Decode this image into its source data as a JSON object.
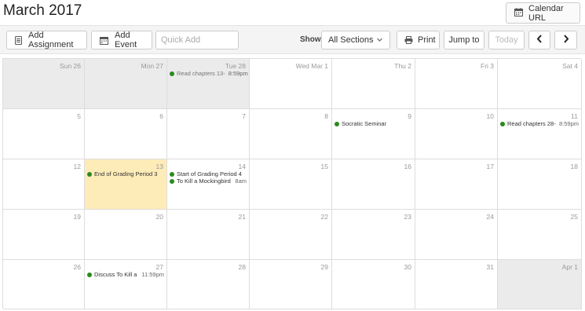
{
  "header": {
    "title": "March 2017",
    "calendar_url_label": "Calendar URL"
  },
  "toolbar": {
    "add_assignment": "Add Assignment",
    "add_event": "Add Event",
    "quick_add_placeholder": "Quick Add",
    "show_label": "Show:",
    "sections_value": "All Sections",
    "print_label": "Print",
    "jump_label": "Jump to",
    "today_label": "Today"
  },
  "icons": {
    "calendar_url": "calendar-icon",
    "add_assignment": "assignment-icon",
    "add_event": "calendar-event-icon",
    "print": "printer-icon",
    "prev": "chevron-left-icon",
    "next": "chevron-right-icon",
    "dropdown": "chevron-down-icon"
  },
  "colors": {
    "event_dot": "#2a8a1e",
    "today_bg": "#fdebb8",
    "outside_month_bg": "#ebebeb"
  },
  "weeks": [
    {
      "days": [
        {
          "label": "Sun 26",
          "state": "past",
          "events": []
        },
        {
          "label": "Mon 27",
          "state": "past",
          "events": []
        },
        {
          "label": "Tue 28",
          "state": "past",
          "events": [
            {
              "title": "Read chapters 13-",
              "time": "8:59pm",
              "faded": true
            }
          ]
        },
        {
          "label": "Wed Mar 1",
          "state": "",
          "events": []
        },
        {
          "label": "Thu 2",
          "state": "",
          "events": []
        },
        {
          "label": "Fri 3",
          "state": "",
          "events": []
        },
        {
          "label": "Sat 4",
          "state": "",
          "events": []
        }
      ]
    },
    {
      "days": [
        {
          "label": "5",
          "state": "",
          "events": []
        },
        {
          "label": "6",
          "state": "",
          "events": []
        },
        {
          "label": "7",
          "state": "",
          "events": []
        },
        {
          "label": "8",
          "state": "",
          "events": []
        },
        {
          "label": "9",
          "state": "",
          "events": [
            {
              "title": "Socratic Seminar",
              "time": ""
            }
          ]
        },
        {
          "label": "10",
          "state": "",
          "events": []
        },
        {
          "label": "11",
          "state": "",
          "events": [
            {
              "title": "Read chapters 28-",
              "time": "8:59pm"
            }
          ]
        }
      ]
    },
    {
      "days": [
        {
          "label": "12",
          "state": "",
          "events": []
        },
        {
          "label": "13",
          "state": "today",
          "events": [
            {
              "title": "End of Grading Period 3",
              "time": ""
            }
          ]
        },
        {
          "label": "14",
          "state": "",
          "events": [
            {
              "title": "Start of Grading Period 4",
              "time": ""
            },
            {
              "title": "To Kill a Mockingbird",
              "time": "8am"
            }
          ]
        },
        {
          "label": "15",
          "state": "",
          "events": []
        },
        {
          "label": "16",
          "state": "",
          "events": []
        },
        {
          "label": "17",
          "state": "",
          "events": []
        },
        {
          "label": "18",
          "state": "",
          "events": []
        }
      ]
    },
    {
      "days": [
        {
          "label": "19",
          "state": "",
          "events": []
        },
        {
          "label": "20",
          "state": "",
          "events": []
        },
        {
          "label": "21",
          "state": "",
          "events": []
        },
        {
          "label": "22",
          "state": "",
          "events": []
        },
        {
          "label": "23",
          "state": "",
          "events": []
        },
        {
          "label": "24",
          "state": "",
          "events": []
        },
        {
          "label": "25",
          "state": "",
          "events": []
        }
      ]
    },
    {
      "days": [
        {
          "label": "26",
          "state": "",
          "events": []
        },
        {
          "label": "27",
          "state": "",
          "events": [
            {
              "title": "Discuss To Kill a",
              "time": "11:59pm"
            }
          ]
        },
        {
          "label": "28",
          "state": "",
          "events": []
        },
        {
          "label": "29",
          "state": "",
          "events": []
        },
        {
          "label": "30",
          "state": "",
          "events": []
        },
        {
          "label": "31",
          "state": "",
          "events": []
        },
        {
          "label": "Apr 1",
          "state": "next",
          "events": []
        }
      ]
    }
  ]
}
